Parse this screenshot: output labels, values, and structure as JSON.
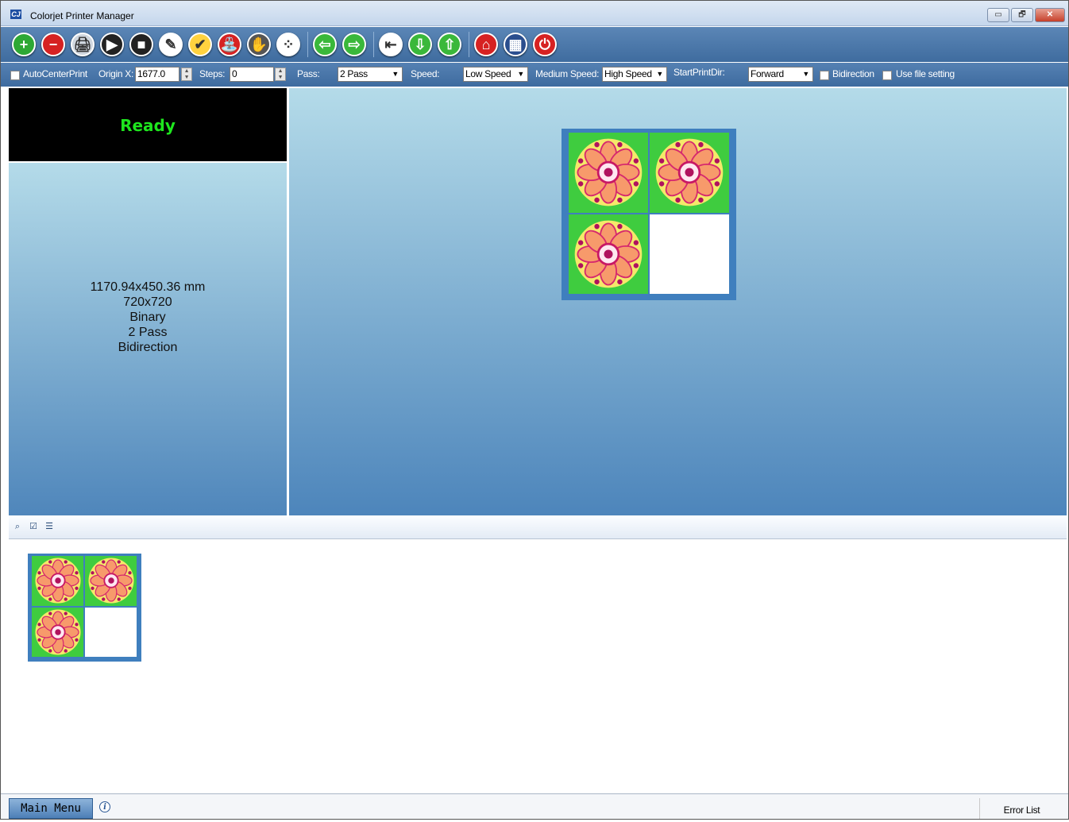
{
  "window": {
    "title": "Colorjet Printer Manager",
    "icon": "CJ"
  },
  "title_buttons": {
    "minimize": "▭",
    "restore": "🗗",
    "close": "✕"
  },
  "toolbar": {
    "buttons": [
      {
        "name": "add-job-icon",
        "color": "#2ea834",
        "glyph": "+"
      },
      {
        "name": "remove-job-icon",
        "color": "#d62222",
        "glyph": "−"
      },
      {
        "name": "print-icon",
        "color": "#cfd6de",
        "glyph": "🖨"
      },
      {
        "name": "resume-icon",
        "color": "#222222",
        "glyph": "▶"
      },
      {
        "name": "stop-icon",
        "color": "#222222",
        "glyph": "■"
      },
      {
        "name": "clean-head-icon",
        "color": "#ffffff",
        "glyph": "✎"
      },
      {
        "name": "check-nozzle-icon",
        "color": "#ffd23f",
        "glyph": "✔"
      },
      {
        "name": "flash-icon",
        "color": "#d62222",
        "glyph": "⛲"
      },
      {
        "name": "pause-hand-icon",
        "color": "#555555",
        "glyph": "✋"
      },
      {
        "name": "color-dots-icon",
        "color": "#ffffff",
        "glyph": "⁘"
      },
      {
        "name": "move-left-icon",
        "color": "#3ab83a",
        "glyph": "⇦"
      },
      {
        "name": "move-right-icon",
        "color": "#3ab83a",
        "glyph": "⇨"
      },
      {
        "name": "set-origin-icon",
        "color": "#ffffff",
        "glyph": "⇤"
      },
      {
        "name": "move-down-icon",
        "color": "#3ab83a",
        "glyph": "⇩"
      },
      {
        "name": "move-up-icon",
        "color": "#3ab83a",
        "glyph": "⇧"
      },
      {
        "name": "home-icon",
        "color": "#d62222",
        "glyph": "⌂"
      },
      {
        "name": "settings-panel-icon",
        "color": "#2a4e8e",
        "glyph": "▦"
      },
      {
        "name": "power-icon",
        "color": "#d62222",
        "glyph": "⏻"
      }
    ]
  },
  "settings": {
    "auto_center_label": "AutoCenterPrint",
    "origin_x_label": "Origin X:",
    "origin_x_value": "1677.0",
    "steps_label": "Steps:",
    "steps_value": "0",
    "pass_label": "Pass:",
    "pass_value": "2 Pass",
    "speed_label": "Speed:",
    "speed_value": "Low Speed",
    "medium_speed_label": "Medium Speed:",
    "medium_speed_value": "High Speed",
    "start_dir_label": "StartPrintDir:",
    "start_dir_value": "Forward",
    "bidirection_label": "Bidirection",
    "use_file_label": "Use file setting"
  },
  "status": {
    "text": "Ready",
    "color": "#1ee61e"
  },
  "job_info": {
    "size": "1170.94x450.36 mm",
    "resolution": "720x720",
    "mode": "Binary",
    "pass": "2 Pass",
    "direction": "Bidirection"
  },
  "strip_icons": [
    "binoculars-icon",
    "document-check-icon",
    "list-icon"
  ],
  "bottom": {
    "main_menu": "Main Menu",
    "error_list": "Error List"
  }
}
